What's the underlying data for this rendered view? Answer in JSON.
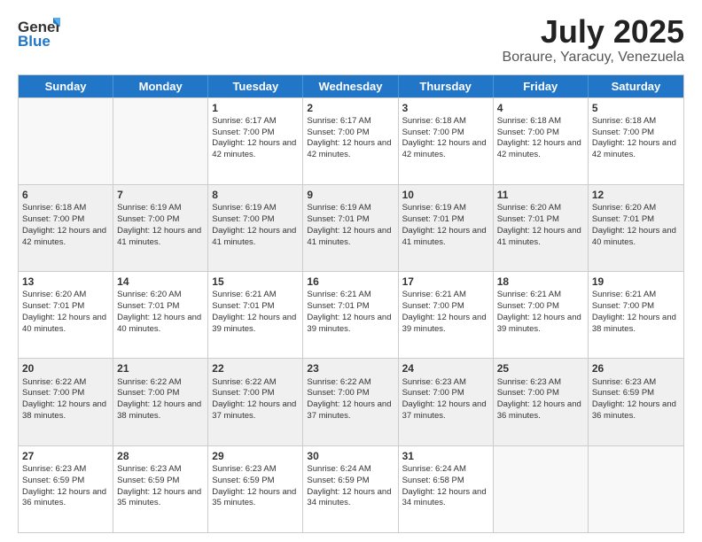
{
  "logo": {
    "general": "General",
    "blue": "Blue"
  },
  "title": {
    "month": "July 2025",
    "location": "Boraure, Yaracuy, Venezuela"
  },
  "weekdays": [
    "Sunday",
    "Monday",
    "Tuesday",
    "Wednesday",
    "Thursday",
    "Friday",
    "Saturday"
  ],
  "weeks": [
    [
      {
        "day": "",
        "sunrise": "",
        "sunset": "",
        "daylight": ""
      },
      {
        "day": "",
        "sunrise": "",
        "sunset": "",
        "daylight": ""
      },
      {
        "day": "1",
        "sunrise": "Sunrise: 6:17 AM",
        "sunset": "Sunset: 7:00 PM",
        "daylight": "Daylight: 12 hours and 42 minutes."
      },
      {
        "day": "2",
        "sunrise": "Sunrise: 6:17 AM",
        "sunset": "Sunset: 7:00 PM",
        "daylight": "Daylight: 12 hours and 42 minutes."
      },
      {
        "day": "3",
        "sunrise": "Sunrise: 6:18 AM",
        "sunset": "Sunset: 7:00 PM",
        "daylight": "Daylight: 12 hours and 42 minutes."
      },
      {
        "day": "4",
        "sunrise": "Sunrise: 6:18 AM",
        "sunset": "Sunset: 7:00 PM",
        "daylight": "Daylight: 12 hours and 42 minutes."
      },
      {
        "day": "5",
        "sunrise": "Sunrise: 6:18 AM",
        "sunset": "Sunset: 7:00 PM",
        "daylight": "Daylight: 12 hours and 42 minutes."
      }
    ],
    [
      {
        "day": "6",
        "sunrise": "Sunrise: 6:18 AM",
        "sunset": "Sunset: 7:00 PM",
        "daylight": "Daylight: 12 hours and 42 minutes."
      },
      {
        "day": "7",
        "sunrise": "Sunrise: 6:19 AM",
        "sunset": "Sunset: 7:00 PM",
        "daylight": "Daylight: 12 hours and 41 minutes."
      },
      {
        "day": "8",
        "sunrise": "Sunrise: 6:19 AM",
        "sunset": "Sunset: 7:00 PM",
        "daylight": "Daylight: 12 hours and 41 minutes."
      },
      {
        "day": "9",
        "sunrise": "Sunrise: 6:19 AM",
        "sunset": "Sunset: 7:01 PM",
        "daylight": "Daylight: 12 hours and 41 minutes."
      },
      {
        "day": "10",
        "sunrise": "Sunrise: 6:19 AM",
        "sunset": "Sunset: 7:01 PM",
        "daylight": "Daylight: 12 hours and 41 minutes."
      },
      {
        "day": "11",
        "sunrise": "Sunrise: 6:20 AM",
        "sunset": "Sunset: 7:01 PM",
        "daylight": "Daylight: 12 hours and 41 minutes."
      },
      {
        "day": "12",
        "sunrise": "Sunrise: 6:20 AM",
        "sunset": "Sunset: 7:01 PM",
        "daylight": "Daylight: 12 hours and 40 minutes."
      }
    ],
    [
      {
        "day": "13",
        "sunrise": "Sunrise: 6:20 AM",
        "sunset": "Sunset: 7:01 PM",
        "daylight": "Daylight: 12 hours and 40 minutes."
      },
      {
        "day": "14",
        "sunrise": "Sunrise: 6:20 AM",
        "sunset": "Sunset: 7:01 PM",
        "daylight": "Daylight: 12 hours and 40 minutes."
      },
      {
        "day": "15",
        "sunrise": "Sunrise: 6:21 AM",
        "sunset": "Sunset: 7:01 PM",
        "daylight": "Daylight: 12 hours and 39 minutes."
      },
      {
        "day": "16",
        "sunrise": "Sunrise: 6:21 AM",
        "sunset": "Sunset: 7:01 PM",
        "daylight": "Daylight: 12 hours and 39 minutes."
      },
      {
        "day": "17",
        "sunrise": "Sunrise: 6:21 AM",
        "sunset": "Sunset: 7:00 PM",
        "daylight": "Daylight: 12 hours and 39 minutes."
      },
      {
        "day": "18",
        "sunrise": "Sunrise: 6:21 AM",
        "sunset": "Sunset: 7:00 PM",
        "daylight": "Daylight: 12 hours and 39 minutes."
      },
      {
        "day": "19",
        "sunrise": "Sunrise: 6:21 AM",
        "sunset": "Sunset: 7:00 PM",
        "daylight": "Daylight: 12 hours and 38 minutes."
      }
    ],
    [
      {
        "day": "20",
        "sunrise": "Sunrise: 6:22 AM",
        "sunset": "Sunset: 7:00 PM",
        "daylight": "Daylight: 12 hours and 38 minutes."
      },
      {
        "day": "21",
        "sunrise": "Sunrise: 6:22 AM",
        "sunset": "Sunset: 7:00 PM",
        "daylight": "Daylight: 12 hours and 38 minutes."
      },
      {
        "day": "22",
        "sunrise": "Sunrise: 6:22 AM",
        "sunset": "Sunset: 7:00 PM",
        "daylight": "Daylight: 12 hours and 37 minutes."
      },
      {
        "day": "23",
        "sunrise": "Sunrise: 6:22 AM",
        "sunset": "Sunset: 7:00 PM",
        "daylight": "Daylight: 12 hours and 37 minutes."
      },
      {
        "day": "24",
        "sunrise": "Sunrise: 6:23 AM",
        "sunset": "Sunset: 7:00 PM",
        "daylight": "Daylight: 12 hours and 37 minutes."
      },
      {
        "day": "25",
        "sunrise": "Sunrise: 6:23 AM",
        "sunset": "Sunset: 7:00 PM",
        "daylight": "Daylight: 12 hours and 36 minutes."
      },
      {
        "day": "26",
        "sunrise": "Sunrise: 6:23 AM",
        "sunset": "Sunset: 6:59 PM",
        "daylight": "Daylight: 12 hours and 36 minutes."
      }
    ],
    [
      {
        "day": "27",
        "sunrise": "Sunrise: 6:23 AM",
        "sunset": "Sunset: 6:59 PM",
        "daylight": "Daylight: 12 hours and 36 minutes."
      },
      {
        "day": "28",
        "sunrise": "Sunrise: 6:23 AM",
        "sunset": "Sunset: 6:59 PM",
        "daylight": "Daylight: 12 hours and 35 minutes."
      },
      {
        "day": "29",
        "sunrise": "Sunrise: 6:23 AM",
        "sunset": "Sunset: 6:59 PM",
        "daylight": "Daylight: 12 hours and 35 minutes."
      },
      {
        "day": "30",
        "sunrise": "Sunrise: 6:24 AM",
        "sunset": "Sunset: 6:59 PM",
        "daylight": "Daylight: 12 hours and 34 minutes."
      },
      {
        "day": "31",
        "sunrise": "Sunrise: 6:24 AM",
        "sunset": "Sunset: 6:58 PM",
        "daylight": "Daylight: 12 hours and 34 minutes."
      },
      {
        "day": "",
        "sunrise": "",
        "sunset": "",
        "daylight": ""
      },
      {
        "day": "",
        "sunrise": "",
        "sunset": "",
        "daylight": ""
      }
    ]
  ]
}
